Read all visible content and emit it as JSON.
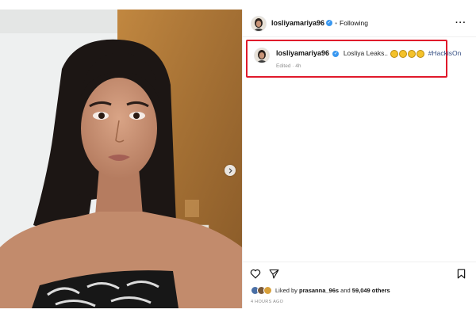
{
  "post": {
    "username": "losliyamariya96",
    "follow_status": "Following",
    "verified": true,
    "caption": {
      "username": "losliyamariya96",
      "text": "Losliya Leaks..",
      "emoji_count": 4,
      "emoji": "grimacing-face",
      "hashtag": "#HackisOn",
      "edited_label": "Edited · 4h"
    },
    "likes": {
      "liked_by_prefix": "Liked by",
      "first_user": "prasanna_96s",
      "and_text": "and",
      "others": "59,049 others"
    },
    "timestamp": "4 HOURS AGO"
  },
  "media": {
    "carousel_total": 4,
    "carousel_active": 1,
    "next_icon": "chevron-right-icon"
  },
  "icons": {
    "more": "more-options-icon",
    "like": "heart-icon",
    "share": "paper-plane-icon",
    "save": "bookmark-icon"
  },
  "colors": {
    "accent": "#3897f0",
    "highlight_box": "#e0192b",
    "hashtag": "#385185",
    "muted_text": "#8e8e8e"
  }
}
